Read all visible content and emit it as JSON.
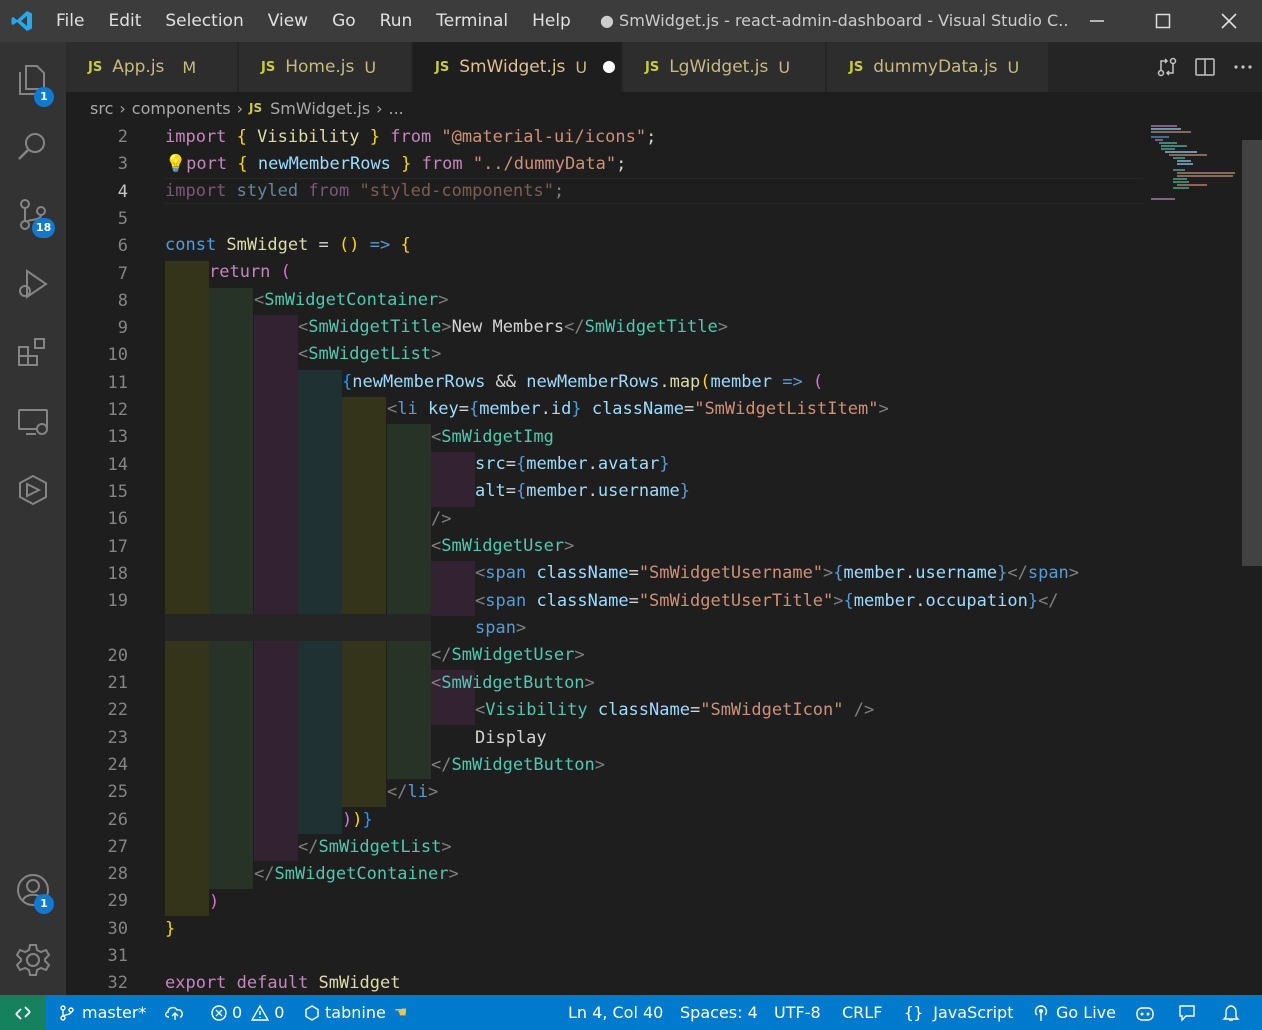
{
  "menu": [
    "File",
    "Edit",
    "Selection",
    "View",
    "Go",
    "Run",
    "Terminal",
    "Help"
  ],
  "window_title": "● SmWidget.js - react-admin-dashboard - Visual Studio C...",
  "activity_badges": {
    "explorer": "1",
    "scm": "18",
    "accounts": "1"
  },
  "tabs": [
    {
      "icon": "JS",
      "name": "App.js",
      "flag": "M"
    },
    {
      "icon": "JS",
      "name": "Home.js",
      "flag": "U"
    },
    {
      "icon": "JS",
      "name": "SmWidget.js",
      "flag": "U"
    },
    {
      "icon": "JS",
      "name": "LgWidget.js",
      "flag": "U"
    },
    {
      "icon": "JS",
      "name": "dummyData.js",
      "flag": "U"
    }
  ],
  "breadcrumb": {
    "folder1": "src",
    "folder2": "components",
    "icon": "JS",
    "file": "SmWidget.js",
    "more": "..."
  },
  "line_numbers": [
    "2",
    "3",
    "4",
    "5",
    "6",
    "7",
    "8",
    "9",
    "10",
    "11",
    "12",
    "13",
    "14",
    "15",
    "16",
    "17",
    "18",
    "19",
    "",
    "20",
    "21",
    "22",
    "23",
    "24",
    "25",
    "26",
    "27",
    "28",
    "29",
    "30",
    "31",
    "32"
  ],
  "code": {
    "l2": [
      "import",
      " ",
      "{",
      " Visibility ",
      "}",
      " from ",
      "\"@material-ui/icons\"",
      ";"
    ],
    "l3": [
      "port",
      " ",
      "{",
      " newMemberRows ",
      "}",
      " from ",
      "\"../dummyData\"",
      ";"
    ],
    "l4": [
      "import",
      " styled ",
      "from",
      " \"styled-components\"",
      ";"
    ],
    "l6": [
      "const",
      " SmWidget ",
      "=",
      " ",
      "()",
      " => ",
      "{"
    ],
    "l7": [
      "return",
      " ",
      "("
    ],
    "l8": [
      "<",
      "SmWidgetContainer",
      ">"
    ],
    "l9": [
      "<",
      "SmWidgetTitle",
      ">",
      "New Members",
      "</",
      "SmWidgetTitle",
      ">"
    ],
    "l10": [
      "<",
      "SmWidgetList",
      ">"
    ],
    "l11": [
      "{",
      "newMemberRows",
      " && ",
      "newMemberRows",
      ".",
      "map",
      "(",
      "member",
      " => ",
      "("
    ],
    "l12": [
      "<",
      "li",
      " key",
      "=",
      "{",
      "member",
      ".",
      "id",
      "}",
      " className",
      "=",
      "\"SmWidgetListItem\"",
      ">"
    ],
    "l13": [
      "<",
      "SmWidgetImg"
    ],
    "l14": [
      "src",
      "=",
      "{",
      "member",
      ".",
      "avatar",
      "}"
    ],
    "l15": [
      "alt",
      "=",
      "{",
      "member",
      ".",
      "username",
      "}"
    ],
    "l16": [
      "/>"
    ],
    "l17": [
      "<",
      "SmWidgetUser",
      ">"
    ],
    "l18": [
      "<",
      "span",
      " className",
      "=",
      "\"SmWidgetUsername\"",
      ">",
      "{",
      "member",
      ".",
      "username",
      "}",
      "</",
      "span",
      ">"
    ],
    "l19": [
      "<",
      "span",
      " className",
      "=",
      "\"SmWidgetUserTitle\"",
      ">",
      "{",
      "member",
      ".",
      "occupation",
      "}",
      "</"
    ],
    "l19b": [
      "span",
      ">"
    ],
    "l20": [
      "</",
      "SmWidgetUser",
      ">"
    ],
    "l21": [
      "<",
      "SmWidgetButton",
      ">"
    ],
    "l22": [
      "<",
      "Visibility",
      " className",
      "=",
      "\"SmWidgetIcon\"",
      " />"
    ],
    "l23": [
      "Display"
    ],
    "l24": [
      "</",
      "SmWidgetButton",
      ">"
    ],
    "l25": [
      "</",
      "li",
      ">"
    ],
    "l26": [
      ")",
      ")",
      "}"
    ],
    "l27": [
      "</",
      "SmWidgetList",
      ">"
    ],
    "l28": [
      "</",
      "SmWidgetContainer",
      ">"
    ],
    "l29": [
      ")"
    ],
    "l30": [
      "}"
    ],
    "l32": [
      "export",
      " default ",
      "SmWidget"
    ]
  },
  "status": {
    "branch": "master*",
    "errors": "0",
    "warnings": "0",
    "tabnine": "tabnine",
    "position": "Ln 4, Col 40",
    "spaces": "Spaces: 4",
    "encoding": "UTF-8",
    "eol": "CRLF",
    "language": "JavaScript",
    "golive": "Go Live"
  },
  "colors": {
    "statusbar": "#007acc",
    "remote": "#16825d",
    "accent_badge": "#0e7ad3",
    "editor_bg": "#1e1e1e"
  }
}
